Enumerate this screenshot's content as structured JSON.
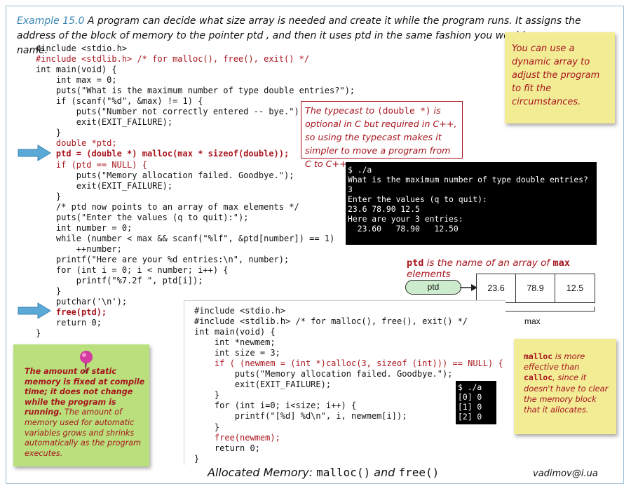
{
  "intro": {
    "example_label": "Example 15.0",
    "text": "A program can decide what size array is needed and create it while the program runs.  It assigns the address of the block of memory to the pointer ptd , and then it uses ptd in the same fashion you would use an array name."
  },
  "code1": {
    "lines": [
      "#include <stdio.h>",
      "#include <stdlib.h> /* for malloc(), free(), exit() */",
      "int main(void) {",
      "    int max = 0;",
      "    puts(\"What is the maximum number of type double entries?\");",
      "    if (scanf(\"%d\", &max) != 1) {",
      "        puts(\"Number not correctly entered -- bye.\");",
      "        exit(EXIT_FAILURE);",
      "    }",
      "    double *ptd;",
      "    ptd = (double *) malloc(max * sizeof(double));",
      "    if (ptd == NULL) {",
      "        puts(\"Memory allocation failed. Goodbye.\");",
      "        exit(EXIT_FAILURE);",
      "    }",
      "    /* ptd now points to an array of max elements */",
      "    puts(\"Enter the values (q to quit):\");",
      "    int number = 0;",
      "    while (number < max && scanf(\"%lf\", &ptd[number]) == 1)",
      "        ++number;",
      "    printf(\"Here are your %d entries:\\n\", number);",
      "    for (int i = 0; i < number; i++) {",
      "        printf(\"%7.2f \", ptd[i]);",
      "    }",
      "    putchar('\\n');",
      "    free(ptd);",
      "    return 0;",
      "}"
    ]
  },
  "typecast_note": {
    "part1": "The typecast to ",
    "code": "(double *)",
    "part2": " is optional in C but required in C++, so using the typecast makes it simpler to move a program from C to C++."
  },
  "terminal1": {
    "lines": [
      "$ ./a",
      "What is the maximum number of type double entries?",
      "3",
      "Enter the values (q to quit):",
      "23.6 78.90 12.5",
      "Here are your 3 entries:",
      "  23.60   78.90   12.50"
    ]
  },
  "sticky_dynamic": "You can use a dynamic array to adjust the program to fit the circumstances.",
  "ptd_diagram": {
    "title_code": "ptd",
    "title_mid": " is the name of an array of ",
    "title_code2": "max",
    "title_end": " elements",
    "pointer_label": "ptd",
    "cells": [
      "23.6",
      "78.9",
      "12.5"
    ],
    "size_label": "max"
  },
  "code2": {
    "lines": [
      "#include <stdio.h>",
      "#include <stdlib.h> /* for malloc(), free(), exit() */",
      "int main(void) {",
      "    int *newmem;",
      "    int size = 3;",
      "    if ( (newmem = (int *)calloc(3, sizeof (int))) == NULL) {",
      "        puts(\"Memory allocation failed. Goodbye.\");",
      "        exit(EXIT_FAILURE);",
      "    }",
      "    for (int i=0; i<size; i++) {",
      "        printf(\"[%d] %d\\n\", i, newmem[i]);",
      "    }",
      "    free(newmem);",
      "    return 0;",
      "}"
    ]
  },
  "terminal2": {
    "lines": [
      "$ ./a",
      "[0] 0",
      "[1] 0",
      "[2] 0"
    ]
  },
  "sticky_static": {
    "bold": "The amount of static memory is fixed at compile time; it does not change while the program is running.",
    "normal": " The amount of memory used for automatic variables grows and shrinks  automatically as the program executes."
  },
  "sticky_malloc": {
    "code1": "malloc",
    "text1": " is more effective than ",
    "code2": "calloc",
    "text2": ", since it doesn't have to clear the memory block that it allocates."
  },
  "footer": {
    "title_a": "Allocated Memory: ",
    "title_code1": "malloc()",
    "title_b": " and ",
    "title_code2": "free()",
    "author": "vadimov@i.ua"
  },
  "colors": {
    "accent_red": "#a8151d",
    "accent_blue": "#3a87b5",
    "sticky_yellow": "#f2ec95",
    "sticky_green": "#b9e07c",
    "pointer_fill": "#cdeccd",
    "arrow_blue": "#5aa9d6"
  },
  "icons": [
    "arrow-right-icon",
    "push-pin-icon"
  ]
}
